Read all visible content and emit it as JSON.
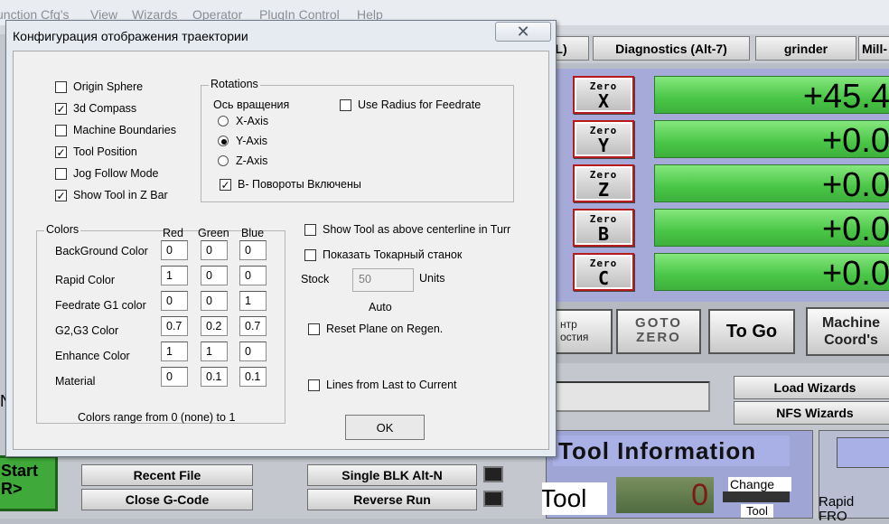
{
  "menu": [
    "unction Cfg's",
    "View",
    "Wizards",
    "Operator",
    "PlugIn Control",
    "Help"
  ],
  "tabs": {
    "partial": "L)",
    "diagnostics": "Diagnostics (Alt-7)",
    "grinder": "grinder",
    "mill": "Mill-"
  },
  "axes": [
    {
      "label": "Zero",
      "axis": "X",
      "value": "+45.4"
    },
    {
      "label": "Zero",
      "axis": "Y",
      "value": "+0.0"
    },
    {
      "label": "Zero",
      "axis": "Z",
      "value": "+0.0"
    },
    {
      "label": "Zero",
      "axis": "B",
      "value": "+0.0"
    },
    {
      "label": "Zero",
      "axis": "C",
      "value": "+0.0"
    }
  ],
  "mid": {
    "center_line1": "нтр",
    "center_line2": "остия",
    "goto_zero_1": "GOTO",
    "goto_zero_2": "ZERO",
    "to_go": "To Go",
    "machine_1": "Machine",
    "machine_2": "Coord's"
  },
  "wizards": {
    "load": "Load Wizards",
    "nfs": "NFS Wizards"
  },
  "tool_info": {
    "title": "Tool Information",
    "tool": "Tool",
    "tool_value": "0",
    "change": "Change",
    "tool_small": "Tool",
    "rapid_1": "Rapid",
    "rapid_2": "FRO"
  },
  "bottom": {
    "start_1": "Start",
    "start_2": "R>",
    "recent": "Recent File",
    "close": "Close G-Code",
    "single": "Single BLK Alt-N",
    "reverse": "Reverse Run",
    "left_n": "N"
  },
  "dialog": {
    "title": "Конфигурация отображения траектории",
    "close_glyph": "✕",
    "checks": [
      {
        "label": "Origin Sphere",
        "checked": false
      },
      {
        "label": "3d Compass",
        "checked": true
      },
      {
        "label": "Machine Boundaries",
        "checked": false
      },
      {
        "label": "Tool Position",
        "checked": true
      },
      {
        "label": "Jog Follow Mode",
        "checked": false
      },
      {
        "label": "Show Tool in Z Bar",
        "checked": true
      }
    ],
    "rotations": {
      "legend": "Rotations",
      "axis_label": "Ось вращения",
      "use_radius": "Use Radius for Feedrate",
      "x": "X-Axis",
      "y": "Y-Axis",
      "z": "Z-Axis",
      "selected": "Y-Axis",
      "b_enabled": "B- Повороты Включены"
    },
    "colors": {
      "legend": "Colors",
      "headers": [
        "Red",
        "Green",
        "Blue"
      ],
      "rows": [
        {
          "label": "BackGround Color",
          "values": [
            "0",
            "0",
            "0"
          ]
        },
        {
          "label": "Rapid Color",
          "values": [
            "1",
            "0",
            "0"
          ]
        },
        {
          "label": "Feedrate G1 color",
          "values": [
            "0",
            "0",
            "1"
          ]
        },
        {
          "label": "G2,G3 Color",
          "values": [
            "0.7",
            "0.2",
            "0.7"
          ]
        },
        {
          "label": "Enhance Color",
          "values": [
            "1",
            "1",
            "0"
          ]
        },
        {
          "label": "Material",
          "values": [
            "0",
            "0.1",
            "0.1"
          ]
        }
      ],
      "range_note": "Colors range from 0 (none) to 1"
    },
    "show_tool_above": "Show Tool as above centerline in Turr",
    "show_lathe": "Показать Токарный станок",
    "stock_label": "Stock",
    "stock_value": "50",
    "units": "Units",
    "auto": "Auto",
    "reset_plane": "Reset Plane on Regen.",
    "lines_from_last": "Lines from Last to Current",
    "ok": "OK"
  }
}
